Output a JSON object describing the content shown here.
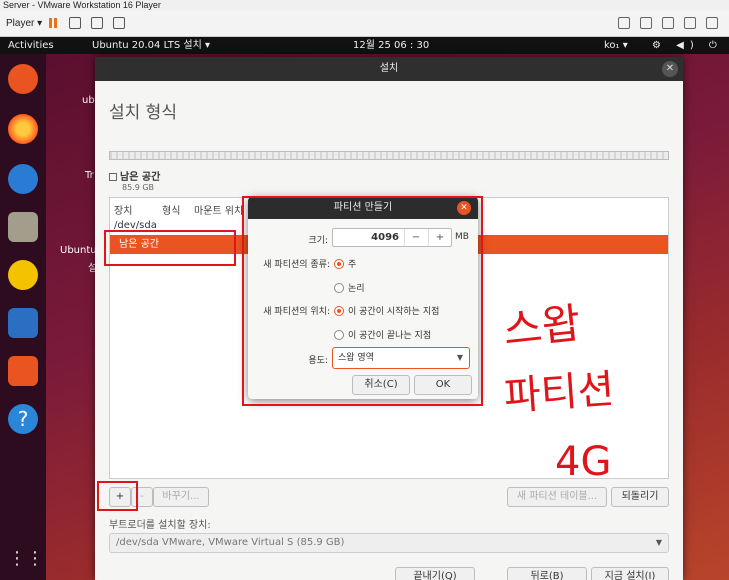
{
  "vmware": {
    "window_title": "Server - VMware Workstation 16 Player",
    "player_menu": "Player ▾"
  },
  "ubuntu_panel": {
    "activities": "Activities",
    "app_menu": "Ubuntu 20.04 LTS 설치 ▾",
    "clock": "12월 25  06 : 30",
    "keyboard": "ko₁ ▾"
  },
  "desktop": {
    "icon_labels": [
      "ub",
      "Tr",
      "Ubuntu",
      "설"
    ]
  },
  "installer": {
    "window_title": "설치",
    "page_title": "설치 형식",
    "legend_name": "남은 공간",
    "legend_size": "85.9 GB",
    "columns": [
      "장치",
      "형식",
      "마운트 위치"
    ],
    "rows": [
      "/dev/sda",
      "남은 공간"
    ],
    "buttons": {
      "add": "+",
      "remove": "-",
      "change": "바꾸기...",
      "new_table": "새 파티션 테이블...",
      "revert": "되돌리기",
      "quit": "끝내기(Q)",
      "back": "뒤로(B)",
      "install_now": "지금 설치(I)"
    },
    "bootloader_label": "부트로더를 설치할 장치:",
    "bootloader_value": "/dev/sda VMware, VMware Virtual S (85.9 GB)"
  },
  "dialog": {
    "title": "파티션 만들기",
    "size_label": "크기:",
    "size_value": "4096",
    "size_unit": "MB",
    "type_label": "새 파티션의 종류:",
    "type_options": [
      "주",
      "논리"
    ],
    "type_selected": "주",
    "location_label": "새 파티션의 위치:",
    "location_options": [
      "이 공간이 시작하는 지점",
      "이 공간이 끝나는 지점"
    ],
    "location_selected": "이 공간이 시작하는 지점",
    "use_label": "용도:",
    "use_value": "스왑 영역",
    "cancel": "취소(C)",
    "ok": "OK"
  },
  "annotation": {
    "handwriting_lines": [
      "스왑",
      "파티션",
      "4G"
    ],
    "color": "#e0151b"
  },
  "colors": {
    "accent": "#e95420",
    "dark_header": "#2c2c2c"
  }
}
